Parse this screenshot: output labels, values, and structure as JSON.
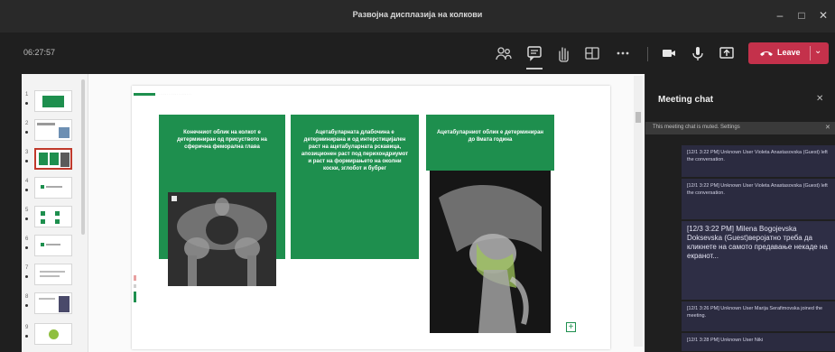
{
  "window": {
    "title": "Развојна дисплазија на колкови",
    "minimize": "–",
    "maximize": "□",
    "close": "✕"
  },
  "toolbar": {
    "timer": "06:27:57",
    "leave_label": "Leave",
    "icons": [
      "people-icon",
      "chat-icon",
      "raise-hand-icon",
      "rooms-icon",
      "more-icon",
      "camera-icon",
      "mic-icon",
      "share-icon",
      "phone-hangup-icon"
    ]
  },
  "slide_panel": {
    "thumbnails": [
      {
        "num": "1"
      },
      {
        "num": "2"
      },
      {
        "num": "3"
      },
      {
        "num": "4"
      },
      {
        "num": "5"
      },
      {
        "num": "6"
      },
      {
        "num": "7"
      },
      {
        "num": "8"
      },
      {
        "num": "9"
      }
    ],
    "selected_index": 2
  },
  "slide": {
    "panels": [
      "Конечниот облик на колкот е детерминиран од присуството на сферична феморална глава",
      "Ацетабуларната длабочина е детерминирана и од интерстицијален раст на ацетабуларната рскавица, апозиционен раст под перихондриумот и раст на формирањето на околни коски, зглобот и бубрег",
      "Ацетабуларниот облик е детерминиран до 8мата година"
    ]
  },
  "chat": {
    "title": "Meeting chat",
    "muted_notice": "This meeting chat is muted. Settings",
    "messages": [
      "[12/1 3:22 PM] Unknown User Violeta Anastasovska (Guest) left the conversation.",
      "[12/1 3:22 PM] Unknown User Violeta Anastasovska (Guest) left the conversation.",
      "[12/3 3:22 PM] Milena Bogojevska Doksevska (Guest)веројатно треба да кликнете на самото предавање некаде на екранот...",
      "[12/1 3:26 PM] Unknown User Marija Serafimovska joined the meeting.",
      "[12/1 3:28 PM] Unknown User Niki"
    ]
  },
  "colors": {
    "slide_green": "#1e8f4e",
    "leave_red": "#c4314b",
    "chat_bubble": "#2b2b40"
  }
}
